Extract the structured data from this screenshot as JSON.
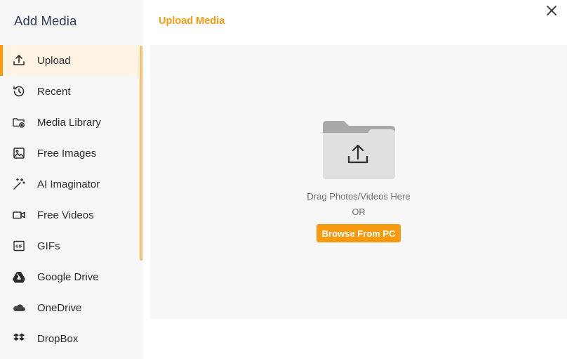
{
  "sidebar": {
    "title": "Add Media",
    "items": [
      {
        "label": "Upload",
        "icon": "upload-icon",
        "active": true
      },
      {
        "label": "Recent",
        "icon": "history-icon"
      },
      {
        "label": "Media Library",
        "icon": "folder-media-icon"
      },
      {
        "label": "Free Images",
        "icon": "image-icon"
      },
      {
        "label": "AI Imaginator",
        "icon": "magic-wand-icon"
      },
      {
        "label": "Free Videos",
        "icon": "video-camera-icon"
      },
      {
        "label": "GIFs",
        "icon": "gif-icon"
      },
      {
        "label": "Google Drive",
        "icon": "google-drive-icon"
      },
      {
        "label": "OneDrive",
        "icon": "onedrive-cloud-icon"
      },
      {
        "label": "DropBox",
        "icon": "dropbox-icon"
      }
    ]
  },
  "main": {
    "title": "Upload Media",
    "drag_text": "Drag Photos/Videos Here",
    "or_text": "OR",
    "browse_label": "Browse From PC"
  },
  "colors": {
    "accent": "#f79a10",
    "active_bg": "#fff3e3",
    "sidebar_bg": "#f7f7f7",
    "title_color": "#2f3b59"
  }
}
